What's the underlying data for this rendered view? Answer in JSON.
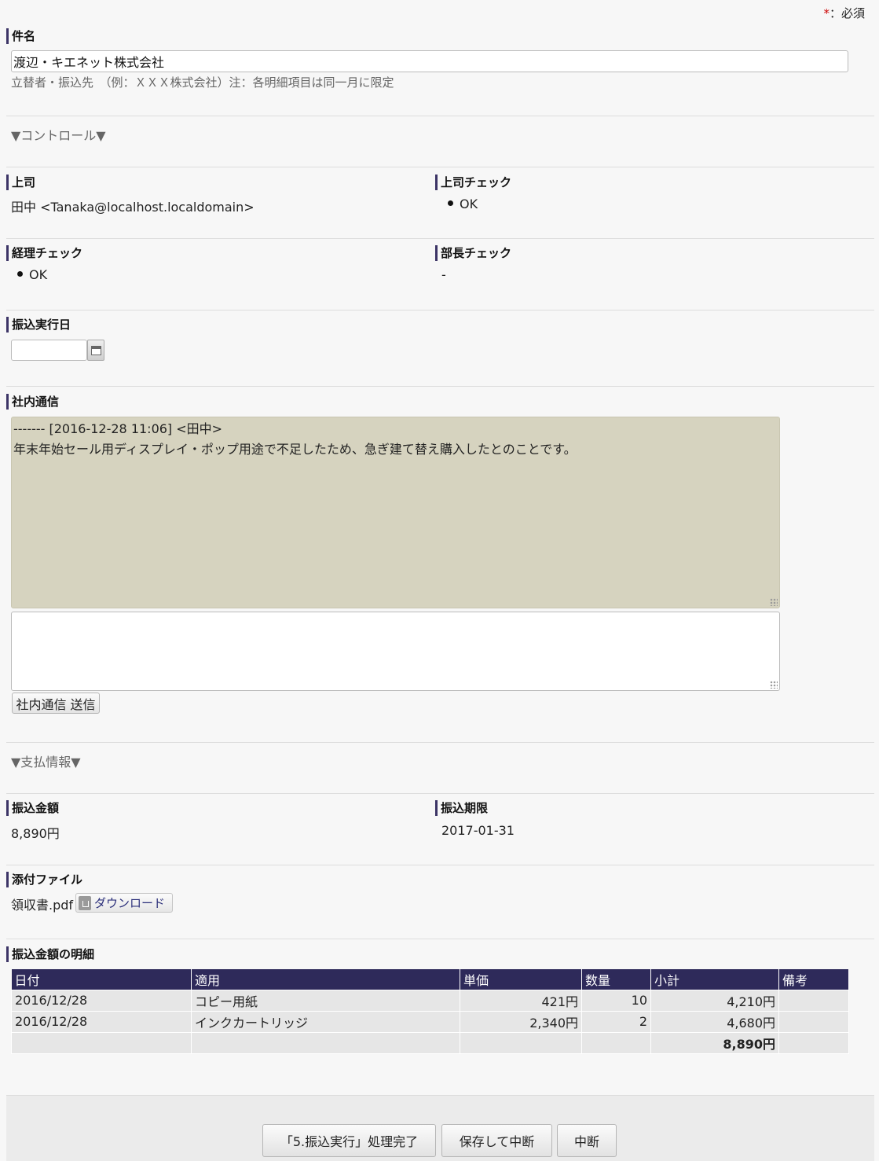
{
  "required_note": {
    "star": "*",
    "text": "：必須"
  },
  "subject": {
    "label": "件名",
    "value": "渡辺・キエネット株式会社",
    "hint": "立替者・振込先　（例：ＸＸＸ株式会社）注：各明細項目は同一月に限定"
  },
  "control_section": {
    "toggle": "▼コントロール▼"
  },
  "boss": {
    "label": "上司",
    "value": "田中 <Tanaka@localhost.localdomain>"
  },
  "boss_check": {
    "label": "上司チェック",
    "value": "OK"
  },
  "accounting_check": {
    "label": "経理チェック",
    "value": "OK"
  },
  "manager_check": {
    "label": "部長チェック",
    "value": "-"
  },
  "transfer_date": {
    "label": "振込実行日",
    "value": ""
  },
  "internal_comm": {
    "label": "社内通信",
    "log_header": "------- [2016-12-28 11:06] <田中>",
    "log_body": "年末年始セール用ディスプレイ・ポップ用途で不足したため、急ぎ建て替え購入したとのことです。",
    "new_message": "",
    "send_label": "社内通信 送信"
  },
  "payment_section": {
    "toggle": "▼支払情報▼"
  },
  "transfer_amount": {
    "label": "振込金額",
    "value": "8,890円"
  },
  "transfer_deadline": {
    "label": "振込期限",
    "value": "2017-01-31"
  },
  "attachment": {
    "label": "添付ファイル",
    "filename": "領収書.pdf",
    "download_label": "ダウンロード"
  },
  "details": {
    "label": "振込金額の明細",
    "columns": [
      "日付",
      "適用",
      "単価",
      "数量",
      "小計",
      "備考"
    ],
    "rows": [
      {
        "date": "2016/12/28",
        "item": "コピー用紙",
        "unit_price": "421円",
        "qty": "10",
        "subtotal": "4,210円",
        "note": ""
      },
      {
        "date": "2016/12/28",
        "item": "インクカートリッジ",
        "unit_price": "2,340円",
        "qty": "2",
        "subtotal": "4,680円",
        "note": ""
      }
    ],
    "total": "8,890円"
  },
  "footer": {
    "complete_label": "「5.振込実行」処理完了",
    "save_pause_label": "保存して中断",
    "pause_label": "中断"
  },
  "colors": {
    "accent": "#2e2a5a",
    "thread_bg": "#d6d3bf",
    "required_star": "#cc0000"
  }
}
